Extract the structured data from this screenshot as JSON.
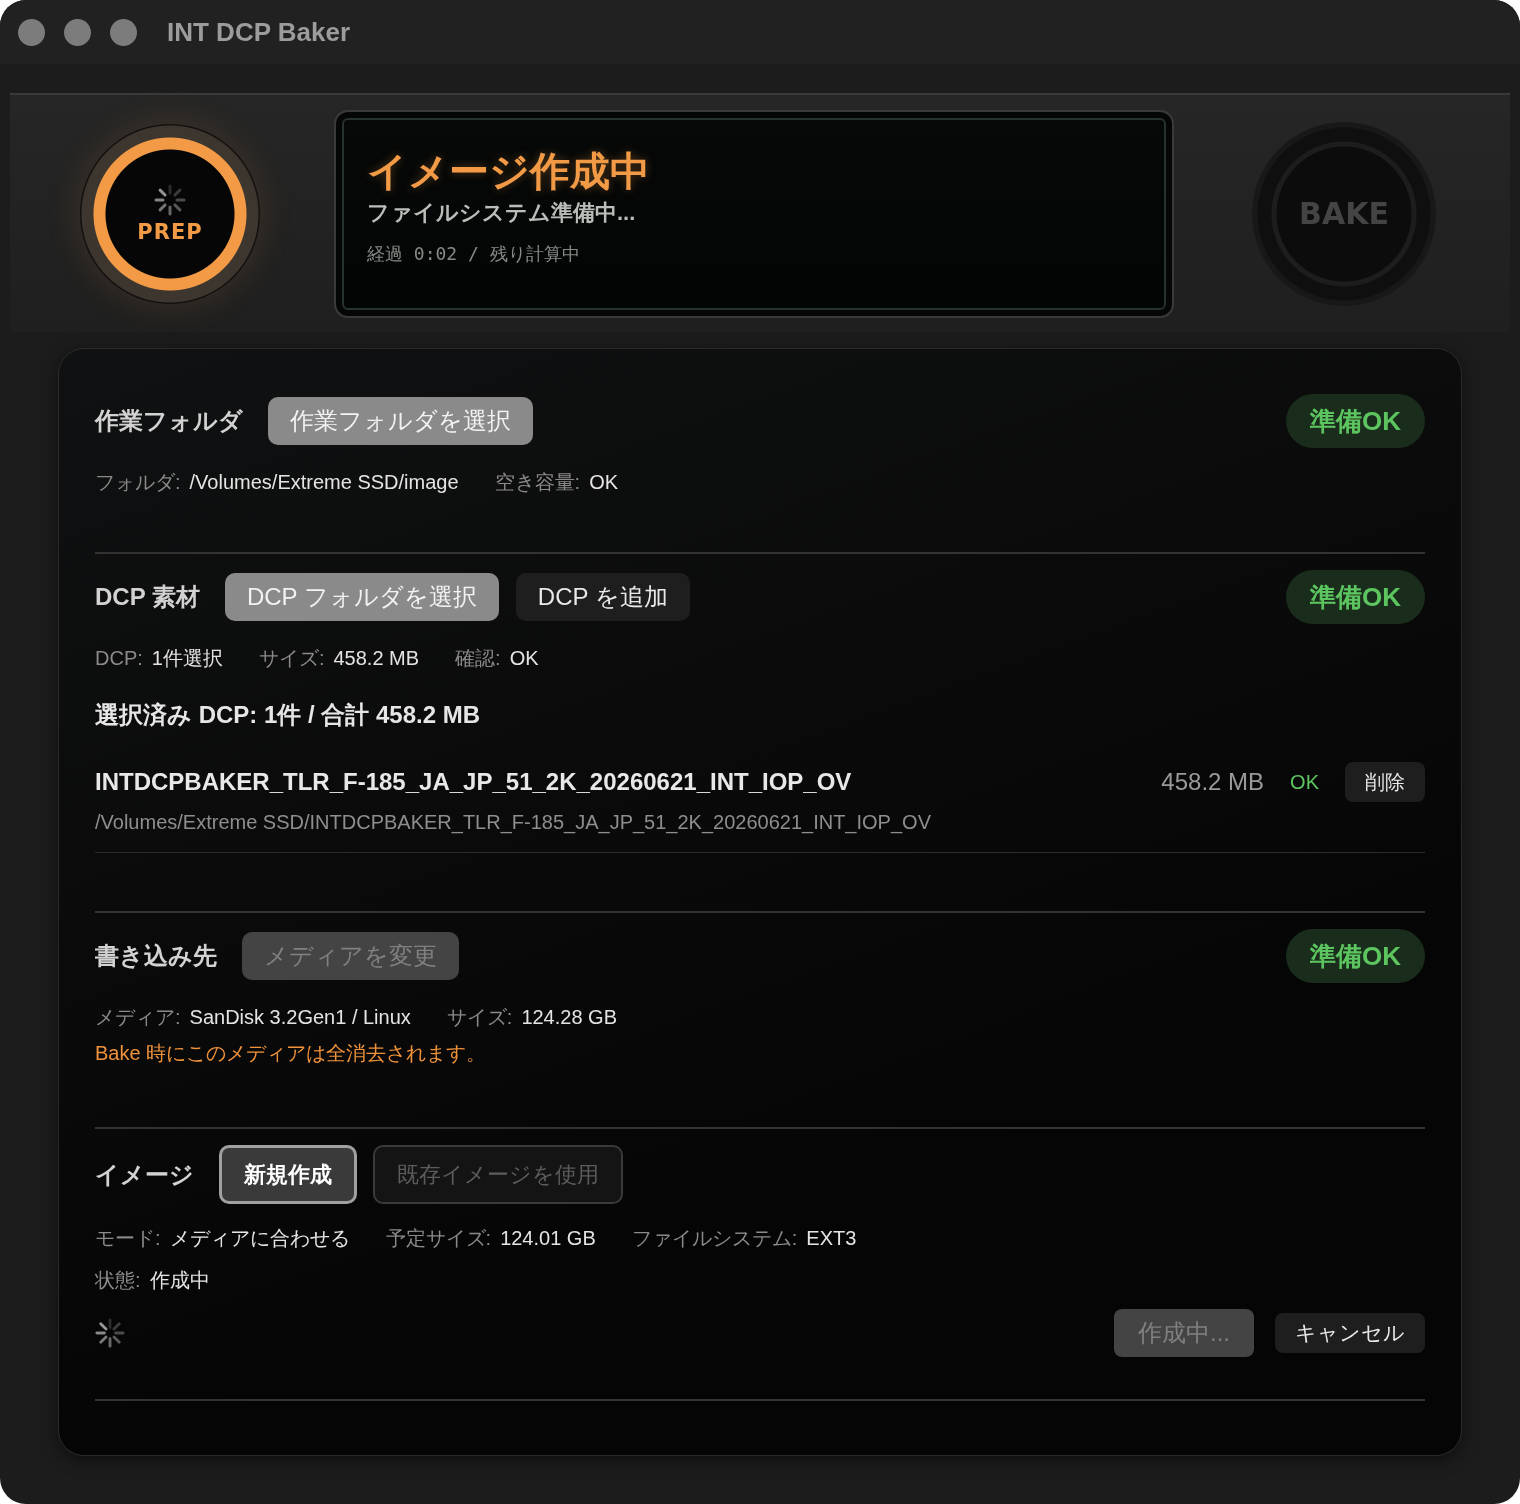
{
  "window": {
    "title": "INT DCP Baker"
  },
  "header": {
    "prep": {
      "label": "PREP",
      "active": true,
      "busy": true
    },
    "status_display": {
      "title": "イメージ作成中",
      "subtitle": "ファイルシステム準備中...",
      "timing": "経過 0:02 / 残り計算中"
    },
    "bake": {
      "label": "BAKE",
      "disabled": true
    }
  },
  "sections": [
    {
      "label": "作業フォルダ",
      "buttons": [
        {
          "label": "作業フォルダを選択",
          "kind": "filled",
          "disabled": false
        }
      ],
      "badge": {
        "label": "準備OK",
        "ready": true
      },
      "info_rows": [
        {
          "fields": [
            {
              "label": "フォルダ:",
              "value": "/Volumes/Extreme SSD/image"
            },
            {
              "label": "空き容量:",
              "value": "OK"
            }
          ]
        }
      ]
    },
    {
      "label": "DCP 素材",
      "buttons": [
        {
          "label": "DCP フォルダを選択",
          "kind": "filled",
          "disabled": false
        },
        {
          "label": "DCP を追加",
          "kind": "plain",
          "disabled": false
        }
      ],
      "badge": {
        "label": "準備OK",
        "ready": true
      },
      "info_rows": [
        {
          "fields": [
            {
              "label": "DCP:",
              "value": "1件選択"
            },
            {
              "label": "サイズ:",
              "value": "458.2 MB"
            },
            {
              "label": "確認:",
              "value": "OK"
            }
          ]
        }
      ],
      "summary": "選択済み DCP: 1件 / 合計 458.2 MB",
      "items": [
        {
          "name": "INTDCPBAKER_TLR_F-185_JA_JP_51_2K_20260621_INT_IOP_OV",
          "path": "/Volumes/Extreme SSD/INTDCPBAKER_TLR_F-185_JA_JP_51_2K_20260621_INT_IOP_OV",
          "size": "458.2 MB",
          "check": "OK",
          "remove_label": "削除"
        }
      ]
    },
    {
      "label": "書き込み先",
      "buttons": [
        {
          "label": "メディアを変更",
          "kind": "filled",
          "disabled": true
        }
      ],
      "badge": {
        "label": "準備OK",
        "ready": true
      },
      "info_rows": [
        {
          "fields": [
            {
              "label": "メディア:",
              "value": "SanDisk 3.2Gen1 / Linux"
            },
            {
              "label": "サイズ:",
              "value": "124.28 GB"
            }
          ]
        }
      ],
      "warning": "Bake 時にこのメディアは全消去されます。"
    },
    {
      "label": "イメージ",
      "modes": [
        {
          "label": "新規作成",
          "selected": true
        },
        {
          "label": "既存イメージを使用",
          "selected": false
        }
      ],
      "info_rows": [
        {
          "fields": [
            {
              "label": "モード:",
              "value": "メディアに合わせる"
            },
            {
              "label": "予定サイズ:",
              "value": "124.01 GB"
            },
            {
              "label": "ファイルシステム:",
              "value": "EXT3"
            }
          ]
        },
        {
          "fields": [
            {
              "label": "状態:",
              "value": "作成中"
            }
          ]
        }
      ],
      "busy": true,
      "actions": [
        {
          "label": "作成中...",
          "kind": "filled",
          "disabled": true
        },
        {
          "label": "キャンセル",
          "kind": "plain",
          "disabled": false
        }
      ]
    }
  ]
}
